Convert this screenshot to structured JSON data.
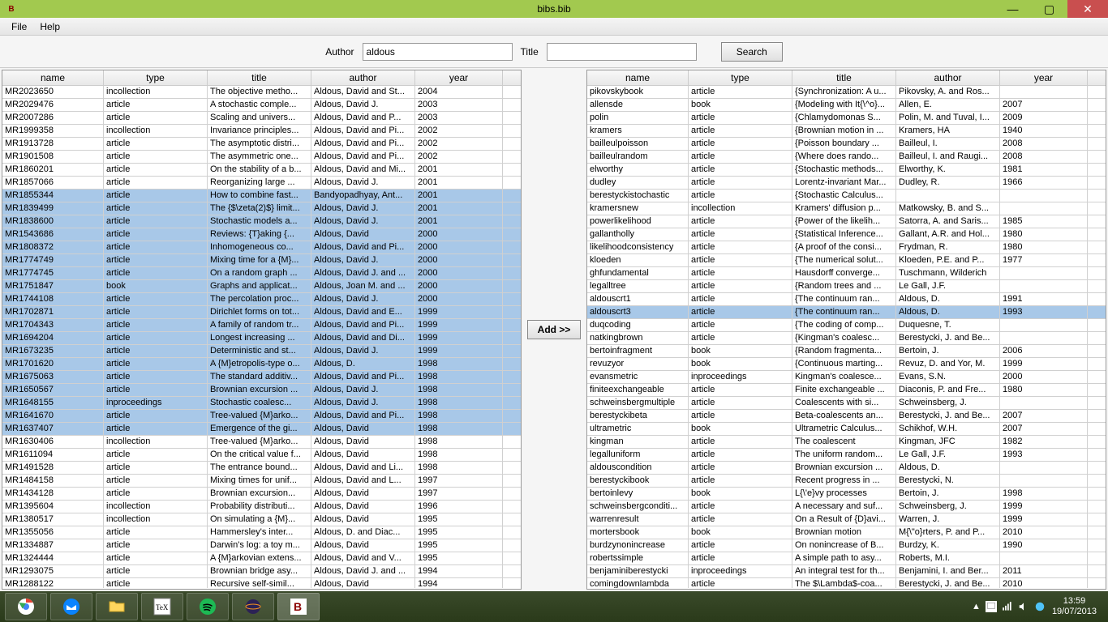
{
  "window": {
    "title": "bibs.bib",
    "icon_text": "B",
    "minimize": "—",
    "maximize": "▢",
    "close": "✕"
  },
  "menu": {
    "file": "File",
    "help": "Help"
  },
  "toolbar": {
    "author_label": "Author",
    "author_value": "aldous",
    "title_label": "Title",
    "title_value": "",
    "search_label": "Search"
  },
  "columns": {
    "name": "name",
    "type": "type",
    "title": "title",
    "author": "author",
    "year": "year"
  },
  "add_button": "Add >>",
  "left_rows": [
    {
      "name": "MR2023650",
      "type": "incollection",
      "title": "The objective metho...",
      "author": "Aldous, David and St...",
      "year": "2004",
      "sel": false
    },
    {
      "name": "MR2029476",
      "type": "article",
      "title": "A stochastic comple...",
      "author": "Aldous, David J.",
      "year": "2003",
      "sel": false
    },
    {
      "name": "MR2007286",
      "type": "article",
      "title": "Scaling and univers...",
      "author": "Aldous, David and P...",
      "year": "2003",
      "sel": false
    },
    {
      "name": "MR1999358",
      "type": "incollection",
      "title": "Invariance principles...",
      "author": "Aldous, David and Pi...",
      "year": "2002",
      "sel": false
    },
    {
      "name": "MR1913728",
      "type": "article",
      "title": "The asymptotic distri...",
      "author": "Aldous, David and Pi...",
      "year": "2002",
      "sel": false
    },
    {
      "name": "MR1901508",
      "type": "article",
      "title": "The asymmetric one...",
      "author": "Aldous, David and Pi...",
      "year": "2002",
      "sel": false
    },
    {
      "name": "MR1860201",
      "type": "article",
      "title": "On the stability of a b...",
      "author": "Aldous, David and Mi...",
      "year": "2001",
      "sel": false
    },
    {
      "name": "MR1857066",
      "type": "article",
      "title": "Reorganizing large ...",
      "author": "Aldous, David J.",
      "year": "2001",
      "sel": false
    },
    {
      "name": "MR1855344",
      "type": "article",
      "title": "How to combine fast...",
      "author": "Bandyopadhyay, Ant...",
      "year": "2001",
      "sel": true
    },
    {
      "name": "MR1839499",
      "type": "article",
      "title": "The {$\\zeta(2)$} limit...",
      "author": "Aldous, David J.",
      "year": "2001",
      "sel": true
    },
    {
      "name": "MR1838600",
      "type": "article",
      "title": "Stochastic models a...",
      "author": "Aldous, David J.",
      "year": "2001",
      "sel": true
    },
    {
      "name": "MR1543686",
      "type": "article",
      "title": "Reviews: {T}aking {...",
      "author": "Aldous, David",
      "year": "2000",
      "sel": true
    },
    {
      "name": "MR1808372",
      "type": "article",
      "title": "Inhomogeneous co...",
      "author": "Aldous, David and Pi...",
      "year": "2000",
      "sel": true
    },
    {
      "name": "MR1774749",
      "type": "article",
      "title": "Mixing time for a {M}...",
      "author": "Aldous, David J.",
      "year": "2000",
      "sel": true
    },
    {
      "name": "MR1774745",
      "type": "article",
      "title": "On a random graph ...",
      "author": "Aldous, David J. and ...",
      "year": "2000",
      "sel": true
    },
    {
      "name": "MR1751847",
      "type": "book",
      "title": "Graphs and applicat...",
      "author": "Aldous, Joan M. and ...",
      "year": "2000",
      "sel": true
    },
    {
      "name": "MR1744108",
      "type": "article",
      "title": "The percolation proc...",
      "author": "Aldous, David J.",
      "year": "2000",
      "sel": true
    },
    {
      "name": "MR1702871",
      "type": "article",
      "title": "Dirichlet forms on tot...",
      "author": "Aldous, David and E...",
      "year": "1999",
      "sel": true
    },
    {
      "name": "MR1704343",
      "type": "article",
      "title": "A family of random tr...",
      "author": "Aldous, David and Pi...",
      "year": "1999",
      "sel": true
    },
    {
      "name": "MR1694204",
      "type": "article",
      "title": "Longest increasing ...",
      "author": "Aldous, David and Di...",
      "year": "1999",
      "sel": true
    },
    {
      "name": "MR1673235",
      "type": "article",
      "title": "Deterministic and st...",
      "author": "Aldous, David J.",
      "year": "1999",
      "sel": true
    },
    {
      "name": "MR1701620",
      "type": "article",
      "title": "A {M}etropolis-type o...",
      "author": "Aldous, D.",
      "year": "1998",
      "sel": true
    },
    {
      "name": "MR1675063",
      "type": "article",
      "title": "The standard additiv...",
      "author": "Aldous, David and Pi...",
      "year": "1998",
      "sel": true
    },
    {
      "name": "MR1650567",
      "type": "article",
      "title": "Brownian excursion ...",
      "author": "Aldous, David J.",
      "year": "1998",
      "sel": true
    },
    {
      "name": "MR1648155",
      "type": "inproceedings",
      "title": "Stochastic coalesc...",
      "author": "Aldous, David J.",
      "year": "1998",
      "sel": true
    },
    {
      "name": "MR1641670",
      "type": "article",
      "title": "Tree-valued {M}arko...",
      "author": "Aldous, David and Pi...",
      "year": "1998",
      "sel": true
    },
    {
      "name": "MR1637407",
      "type": "article",
      "title": "Emergence of the gi...",
      "author": "Aldous, David",
      "year": "1998",
      "sel": true
    },
    {
      "name": "MR1630406",
      "type": "incollection",
      "title": "Tree-valued {M}arko...",
      "author": "Aldous, David",
      "year": "1998",
      "sel": false
    },
    {
      "name": "MR1611094",
      "type": "article",
      "title": "On the critical value f...",
      "author": "Aldous, David",
      "year": "1998",
      "sel": false
    },
    {
      "name": "MR1491528",
      "type": "article",
      "title": "The entrance bound...",
      "author": "Aldous, David and Li...",
      "year": "1998",
      "sel": false
    },
    {
      "name": "MR1484158",
      "type": "article",
      "title": "Mixing times for unif...",
      "author": "Aldous, David and L...",
      "year": "1997",
      "sel": false
    },
    {
      "name": "MR1434128",
      "type": "article",
      "title": "Brownian excursion...",
      "author": "Aldous, David",
      "year": "1997",
      "sel": false
    },
    {
      "name": "MR1395604",
      "type": "incollection",
      "title": "Probability distributi...",
      "author": "Aldous, David",
      "year": "1996",
      "sel": false
    },
    {
      "name": "MR1380517",
      "type": "incollection",
      "title": "On simulating a {M}...",
      "author": "Aldous, David",
      "year": "1995",
      "sel": false
    },
    {
      "name": "MR1355056",
      "type": "article",
      "title": "Hammersley's inter...",
      "author": "Aldous, D. and Diac...",
      "year": "1995",
      "sel": false
    },
    {
      "name": "MR1334887",
      "type": "article",
      "title": "Darwin's log: a toy m...",
      "author": "Aldous, David",
      "year": "1995",
      "sel": false
    },
    {
      "name": "MR1324444",
      "type": "article",
      "title": "A {M}arkovian extens...",
      "author": "Aldous, David and V...",
      "year": "1995",
      "sel": false
    },
    {
      "name": "MR1293075",
      "type": "article",
      "title": "Brownian bridge asy...",
      "author": "Aldous, David J. and ...",
      "year": "1994",
      "sel": false
    },
    {
      "name": "MR1288122",
      "type": "article",
      "title": "Recursive self-simil...",
      "author": "Aldous, David",
      "year": "1994",
      "sel": false
    }
  ],
  "right_rows": [
    {
      "name": "pikovskybook",
      "type": "article",
      "title": "{Synchronization: A u...",
      "author": "Pikovsky, A. and Ros...",
      "year": "",
      "sel": false
    },
    {
      "name": "allensde",
      "type": "book",
      "title": "{Modeling with It{\\^o}...",
      "author": "Allen, E.",
      "year": "2007",
      "sel": false
    },
    {
      "name": "polin",
      "type": "article",
      "title": "{Chlamydomonas S...",
      "author": "Polin, M. and Tuval, I...",
      "year": "2009",
      "sel": false
    },
    {
      "name": "kramers",
      "type": "article",
      "title": "{Brownian motion in ...",
      "author": "Kramers, HA",
      "year": "1940",
      "sel": false
    },
    {
      "name": "bailleulpoisson",
      "type": "article",
      "title": "{Poisson boundary ...",
      "author": "Bailleul, I.",
      "year": "2008",
      "sel": false
    },
    {
      "name": "bailleulrandom",
      "type": "article",
      "title": "{Where does rando...",
      "author": "Bailleul, I. and Raugi...",
      "year": "2008",
      "sel": false
    },
    {
      "name": "elworthy",
      "type": "article",
      "title": "{Stochastic methods...",
      "author": "Elworthy, K.",
      "year": "1981",
      "sel": false
    },
    {
      "name": "dudley",
      "type": "article",
      "title": "Lorentz-invariant Mar...",
      "author": "Dudley, R.",
      "year": "1966",
      "sel": false
    },
    {
      "name": "berestyckistochastic",
      "type": "article",
      "title": "{Stochastic Calculus...",
      "author": "",
      "year": "",
      "sel": false
    },
    {
      "name": "kramersnew",
      "type": "incollection",
      "title": "Kramers' diffusion p...",
      "author": "Matkowsky, B. and S...",
      "year": "",
      "sel": false
    },
    {
      "name": "powerlikelihood",
      "type": "article",
      "title": "{Power of the likelih...",
      "author": "Satorra, A. and Saris...",
      "year": "1985",
      "sel": false
    },
    {
      "name": "gallantholly",
      "type": "article",
      "title": "{Statistical Inference...",
      "author": "Gallant, A.R. and Hol...",
      "year": "1980",
      "sel": false
    },
    {
      "name": "likelihoodconsistency",
      "type": "article",
      "title": "{A proof of the consi...",
      "author": "Frydman, R.",
      "year": "1980",
      "sel": false
    },
    {
      "name": "kloeden",
      "type": "article",
      "title": "{The numerical solut...",
      "author": "Kloeden, P.E. and P...",
      "year": "1977",
      "sel": false
    },
    {
      "name": "ghfundamental",
      "type": "article",
      "title": "Hausdorff converge...",
      "author": "Tuschmann, Wilderich",
      "year": "",
      "sel": false
    },
    {
      "name": "legalltree",
      "type": "article",
      "title": "{Random trees and ...",
      "author": "Le Gall, J.F.",
      "year": "",
      "sel": false
    },
    {
      "name": "aldouscrt1",
      "type": "article",
      "title": "{The continuum ran...",
      "author": "Aldous, D.",
      "year": "1991",
      "sel": false
    },
    {
      "name": "aldouscrt3",
      "type": "article",
      "title": "{The continuum ran...",
      "author": "Aldous, D.",
      "year": "1993",
      "sel": true
    },
    {
      "name": "duqcoding",
      "type": "article",
      "title": "{The coding of comp...",
      "author": "Duquesne, T.",
      "year": "",
      "sel": false
    },
    {
      "name": "natkingbrown",
      "type": "article",
      "title": "{Kingman's coalesc...",
      "author": "Berestycki, J. and Be...",
      "year": "",
      "sel": false
    },
    {
      "name": "bertoinfragment",
      "type": "book",
      "title": "{Random fragmenta...",
      "author": "Bertoin, J.",
      "year": "2006",
      "sel": false
    },
    {
      "name": "revuzyor",
      "type": "book",
      "title": "{Continuous marting...",
      "author": "Revuz, D. and Yor, M.",
      "year": "1999",
      "sel": false
    },
    {
      "name": "evansmetric",
      "type": "inproceedings",
      "title": "Kingman's coalesce...",
      "author": "Evans, S.N.",
      "year": "2000",
      "sel": false
    },
    {
      "name": "finiteexchangeable",
      "type": "article",
      "title": "Finite exchangeable ...",
      "author": "Diaconis, P. and Fre...",
      "year": "1980",
      "sel": false
    },
    {
      "name": "schweinsbergmultiple",
      "type": "article",
      "title": "Coalescents with si...",
      "author": "Schweinsberg, J.",
      "year": "",
      "sel": false
    },
    {
      "name": "berestyckibeta",
      "type": "article",
      "title": "Beta-coalescents an...",
      "author": "Berestycki, J. and Be...",
      "year": "2007",
      "sel": false
    },
    {
      "name": "ultrametric",
      "type": "book",
      "title": "Ultrametric Calculus...",
      "author": "Schikhof, W.H.",
      "year": "2007",
      "sel": false
    },
    {
      "name": "kingman",
      "type": "article",
      "title": "The coalescent",
      "author": "Kingman, JFC",
      "year": "1982",
      "sel": false
    },
    {
      "name": "legalluniform",
      "type": "article",
      "title": "The uniform random...",
      "author": "Le Gall, J.F.",
      "year": "1993",
      "sel": false
    },
    {
      "name": "aldouscondition",
      "type": "article",
      "title": "Brownian excursion ...",
      "author": "Aldous, D.",
      "year": "",
      "sel": false
    },
    {
      "name": "berestyckibook",
      "type": "article",
      "title": "Recent progress in ...",
      "author": "Berestycki, N.",
      "year": "",
      "sel": false
    },
    {
      "name": "bertoinlevy",
      "type": "book",
      "title": "L{\\'e}vy processes",
      "author": "Bertoin, J.",
      "year": "1998",
      "sel": false
    },
    {
      "name": "schweinsbergconditi...",
      "type": "article",
      "title": "A necessary and suf...",
      "author": "Schweinsberg, J.",
      "year": "1999",
      "sel": false
    },
    {
      "name": "warrenresult",
      "type": "article",
      "title": "On a Result of {D}avi...",
      "author": "Warren, J.",
      "year": "1999",
      "sel": false
    },
    {
      "name": "mortersbook",
      "type": "book",
      "title": "Brownian motion",
      "author": "M{\\\"o}rters, P. and P...",
      "year": "2010",
      "sel": false
    },
    {
      "name": "burdzynonincrease",
      "type": "article",
      "title": "On nonincrease of B...",
      "author": "Burdzy, K.",
      "year": "1990",
      "sel": false
    },
    {
      "name": "robertssimple",
      "type": "article",
      "title": "A simple path to asy...",
      "author": "Roberts, M.I.",
      "year": "",
      "sel": false
    },
    {
      "name": "benjaminiberestycki",
      "type": "inproceedings",
      "title": "An integral test for th...",
      "author": "Benjamini, I. and Ber...",
      "year": "2011",
      "sel": false
    },
    {
      "name": "comingdownlambda",
      "type": "article",
      "title": "The $\\Lambda$-coa...",
      "author": "Berestycki, J. and Be...",
      "year": "2010",
      "sel": false
    }
  ],
  "clock": {
    "time": "13:59",
    "date": "19/07/2013"
  },
  "tray": {
    "chevron": "▲"
  }
}
